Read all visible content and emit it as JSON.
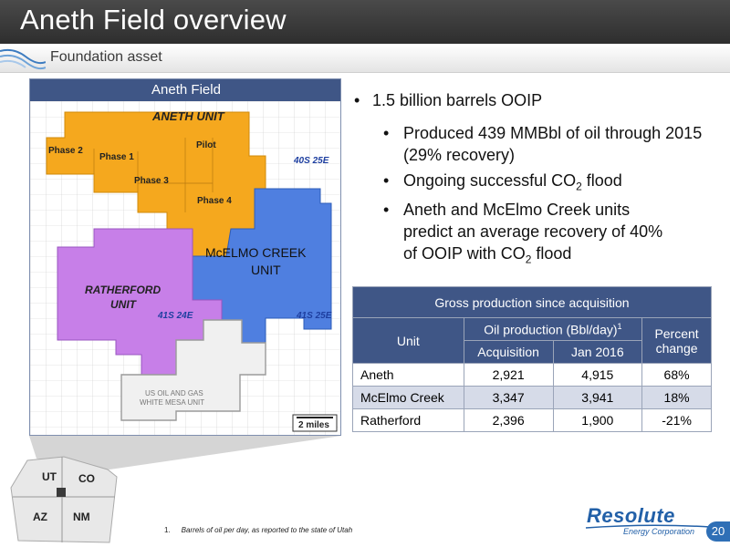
{
  "slide": {
    "title": "Aneth Field overview",
    "subtitle": "Foundation asset",
    "page_number": "20"
  },
  "map": {
    "header": "Aneth Field",
    "labels": {
      "aneth_unit": "ANETH UNIT",
      "phase2": "Phase 2",
      "phase1": "Phase 1",
      "pilot": "Pilot",
      "phase3": "Phase 3",
      "phase4": "Phase 4",
      "township_40s25e": "40S 25E",
      "mcelmo_line1": "McELMO CREEK",
      "mcelmo_line2": "UNIT",
      "ratherford_line1": "RATHERFORD",
      "ratherford_line2": "UNIT",
      "township_41s24e": "41S 24E",
      "township_41s25e": "41S 25E",
      "white_mesa_line1": "US OIL AND GAS",
      "white_mesa_line2": "WHITE MESA UNIT",
      "scale": "2 miles"
    },
    "colors": {
      "aneth": "#f5a81e",
      "mcelmo": "#4f7fe0",
      "ratherford": "#c77fe8",
      "white_mesa": "#d9d9d9",
      "header": "#3f5686"
    },
    "states": [
      "UT",
      "CO",
      "AZ",
      "NM"
    ]
  },
  "bullets": {
    "main": "1.5 billion barrels OOIP",
    "sub1": "Produced 439 MMBbl of oil through 2015 (29% recovery)",
    "sub2_pre": "Ongoing successful CO",
    "sub2_sub": "2",
    "sub2_post": " flood",
    "sub3_line1": "Aneth and McElmo Creek units",
    "sub3_line2": "predict an average recovery of 40%",
    "sub3_line3_pre": "of OOIP with CO",
    "sub3_line3_sub": "2",
    "sub3_line3_post": " flood"
  },
  "table": {
    "title": "Gross production since acquisition",
    "col_unit": "Unit",
    "col_oil": "Oil production (Bbl/day)",
    "col_oil_sup": "1",
    "col_pct": "Percent change",
    "col_acq": "Acquisition",
    "col_jan": "Jan 2016",
    "rows": [
      {
        "unit": "Aneth",
        "acq": "2,921",
        "jan": "4,915",
        "pct": "68%"
      },
      {
        "unit": "McElmo Creek",
        "acq": "3,347",
        "jan": "3,941",
        "pct": "18%"
      },
      {
        "unit": "Ratherford",
        "acq": "2,396",
        "jan": "1,900",
        "pct": "-21%"
      }
    ]
  },
  "footnote": {
    "number": "1.",
    "text": "Barrels of oil per day, as reported to the state of Utah"
  },
  "logo": {
    "name": "Resolute",
    "sub": "Energy Corporation"
  }
}
